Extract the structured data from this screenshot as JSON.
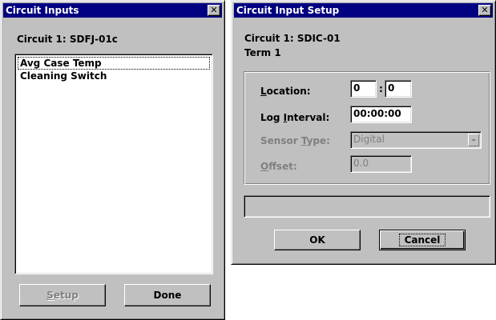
{
  "left_window": {
    "title": "Circuit Inputs",
    "circuit_label": "Circuit 1: SDFJ-01c",
    "list_items": [
      "Avg Case Temp",
      "Cleaning Switch"
    ],
    "setup_button": "Setup",
    "setup_mnemonic": "S",
    "done_button": "Done"
  },
  "right_window": {
    "title": "Circuit Input Setup",
    "circuit_label": "Circuit 1: SDIC-01",
    "term_label": "Term 1",
    "location": {
      "label_mn": "L",
      "label_rest": "ocation:",
      "value_a": "0",
      "separator": ":",
      "value_b": "0"
    },
    "log_interval": {
      "label_pre": "Log ",
      "label_mn": "I",
      "label_rest": "nterval:",
      "value": "00:00:00"
    },
    "sensor_type": {
      "label_pre": "Sensor ",
      "label_mn": "T",
      "label_rest": "ype:",
      "value": "Digital"
    },
    "offset": {
      "label_mn": "O",
      "label_rest": "ffset:",
      "value": "0.0"
    },
    "status_text": "",
    "ok_button": "OK",
    "cancel_button": "Cancel"
  },
  "icons": {
    "close": "close-icon",
    "dropdown": "chevron-down-icon"
  }
}
